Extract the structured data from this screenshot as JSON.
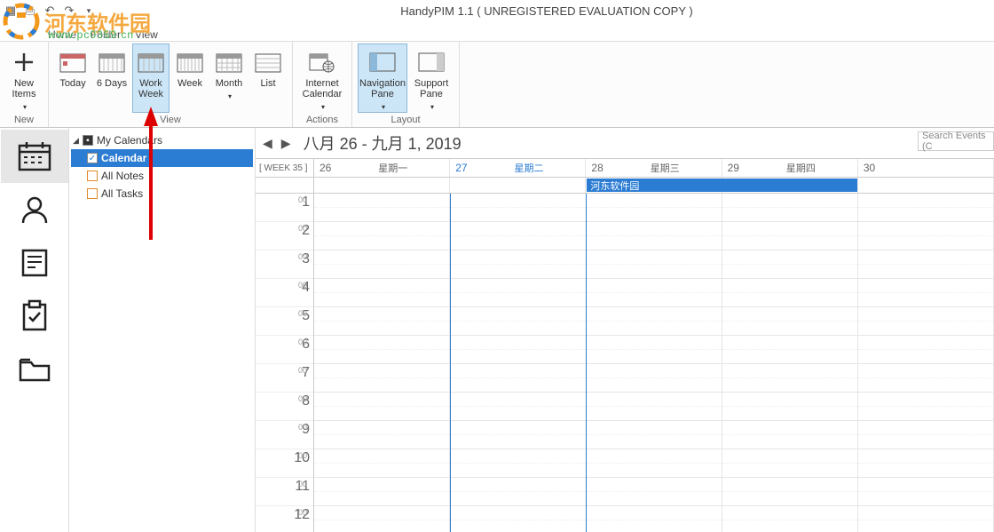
{
  "app_title": "HandyPIM 1.1 ( UNREGISTERED EVALUATION COPY )",
  "menu": {
    "home": "Home",
    "folder": "Folder",
    "view": "View"
  },
  "ribbon": {
    "new": {
      "new_items": "New\nItems",
      "group": "New"
    },
    "view": {
      "today": "Today",
      "six_days": "6 Days",
      "work_week": "Work\nWeek",
      "week": "Week",
      "month": "Month",
      "list": "List",
      "group": "View"
    },
    "actions": {
      "internet_calendar": "Internet\nCalendar",
      "group": "Actions"
    },
    "layout": {
      "navigation_pane": "Navigation\nPane",
      "support_pane": "Support\nPane",
      "group": "Layout"
    }
  },
  "tree": {
    "root": "My Calendars",
    "items": [
      {
        "label": "Calendar",
        "checked": true,
        "selected": true
      },
      {
        "label": "All Notes",
        "checked": false
      },
      {
        "label": "All Tasks",
        "checked": false
      }
    ]
  },
  "calendar": {
    "range": "八月 26 - 九月 1, 2019",
    "week_label": "[ WEEK 35 ]",
    "search_placeholder": "Search Events (C",
    "days": [
      {
        "num": "26",
        "name": "星期一",
        "today": false
      },
      {
        "num": "27",
        "name": "星期二",
        "today": true
      },
      {
        "num": "28",
        "name": "星期三",
        "today": false
      },
      {
        "num": "29",
        "name": "星期四",
        "today": false
      },
      {
        "num": "30",
        "name": "",
        "today": false
      }
    ],
    "hours": [
      "1",
      "2",
      "3",
      "4",
      "5",
      "6",
      "7",
      "8",
      "9",
      "10",
      "11",
      "12"
    ],
    "minute_label": "00",
    "allday_event": {
      "day_index": 2,
      "span": 2,
      "label": "河东软件园"
    }
  },
  "watermark": {
    "text": "河东软件园",
    "url": "www.pc0359.cn"
  }
}
